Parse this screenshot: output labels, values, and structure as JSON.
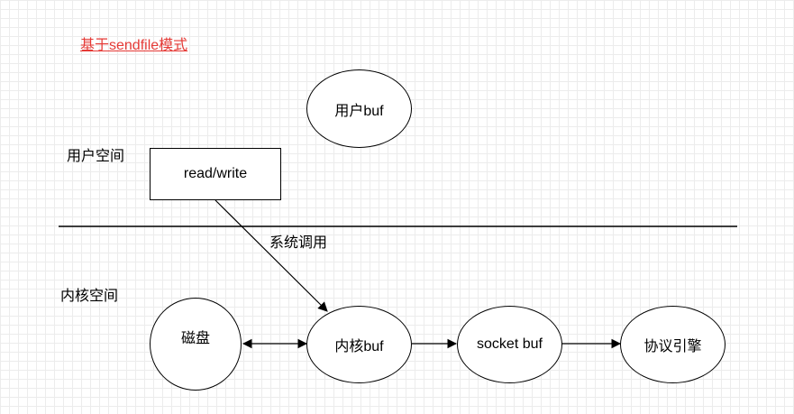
{
  "title": "基于sendfile模式",
  "regions": {
    "user_space": "用户空间",
    "kernel_space": "内核空间"
  },
  "nodes": {
    "user_buf": "用户buf",
    "read_write": "read/write",
    "disk": "磁盘",
    "kernel_buf": "内核buf",
    "socket_buf": "socket buf",
    "protocol_engine": "协议引擎"
  },
  "edges": {
    "syscall_label": "系统调用"
  },
  "colors": {
    "title": "#e53935",
    "stroke": "#000000",
    "grid": "#ececec"
  }
}
